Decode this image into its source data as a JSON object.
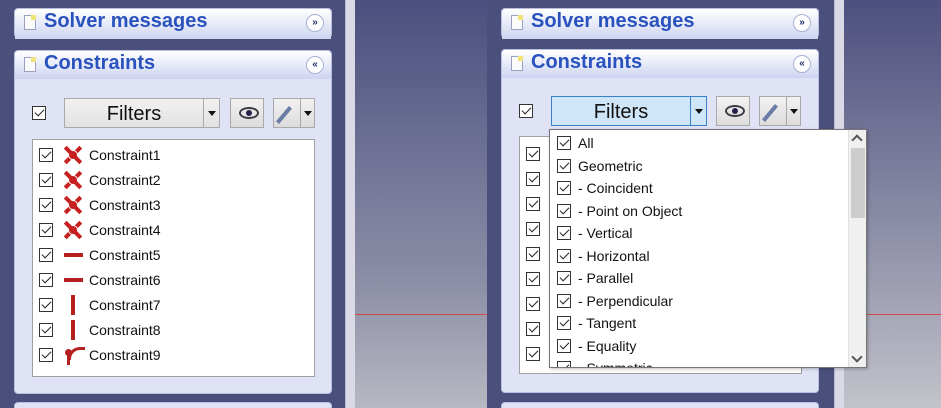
{
  "left_panel": {
    "solver_title": "Solver messages",
    "solver_toggle": "»",
    "constraints_title": "Constraints",
    "constraints_toggle": "«",
    "filters_label": "Filters",
    "constraints": [
      {
        "name": "Constraint1",
        "icon": "coincident-icon"
      },
      {
        "name": "Constraint2",
        "icon": "coincident-icon"
      },
      {
        "name": "Constraint3",
        "icon": "coincident-icon"
      },
      {
        "name": "Constraint4",
        "icon": "coincident-icon"
      },
      {
        "name": "Constraint5",
        "icon": "horizontal-icon"
      },
      {
        "name": "Constraint6",
        "icon": "horizontal-icon"
      },
      {
        "name": "Constraint7",
        "icon": "vertical-icon"
      },
      {
        "name": "Constraint8",
        "icon": "vertical-icon"
      },
      {
        "name": "Constraint9",
        "icon": "tangent-icon"
      }
    ]
  },
  "right_panel": {
    "solver_title": "Solver messages",
    "solver_toggle": "»",
    "constraints_title": "Constraints",
    "constraints_toggle": "«",
    "filters_label": "Filters",
    "filter_options": [
      "All",
      "Geometric",
      "- Coincident",
      "- Point on Object",
      "- Vertical",
      "- Horizontal",
      "- Parallel",
      "- Perpendicular",
      "- Tangent",
      "- Equality",
      "- Symmetric"
    ]
  },
  "colors": {
    "panel_bg": "#4a4f7c",
    "header_title": "#2a52be",
    "constraint_red": "#c62020",
    "axis_line": "#d24b4b"
  }
}
